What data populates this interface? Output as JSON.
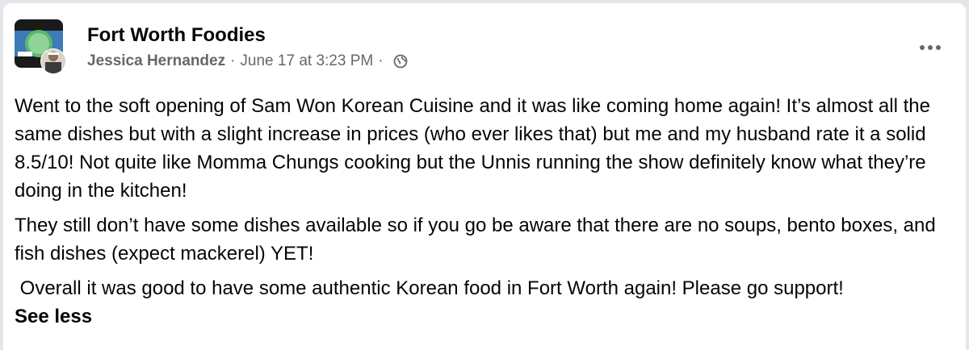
{
  "post": {
    "group_name": "Fort Worth Foodies",
    "author": "Jessica Hernandez",
    "separator": "·",
    "timestamp": "June 17 at 3:23 PM",
    "privacy_icon": "globe-icon",
    "more_icon": "more-options-icon",
    "body": {
      "paragraph_1": "Went to the soft opening of Sam Won Korean Cuisine and it was like coming home again! It’s almost all the same dishes but with a slight increase in prices (who ever likes that) but me and my husband rate it a solid 8.5/10! Not quite like Momma Chungs cooking but the Unnis running the show definitely know what they’re doing in the kitchen!",
      "paragraph_2": "They still don’t have some dishes available so if you go be aware that there are no soups, bento boxes, and fish dishes (expect mackerel) YET!",
      "paragraph_3": " Overall it was good to have some authentic Korean food in Fort Worth again! Please go support!"
    },
    "see_less_label": "See less"
  },
  "colors": {
    "text_primary": "#050505",
    "text_secondary": "#65676b",
    "background": "#ffffff",
    "page_background": "#e4e6eb"
  }
}
